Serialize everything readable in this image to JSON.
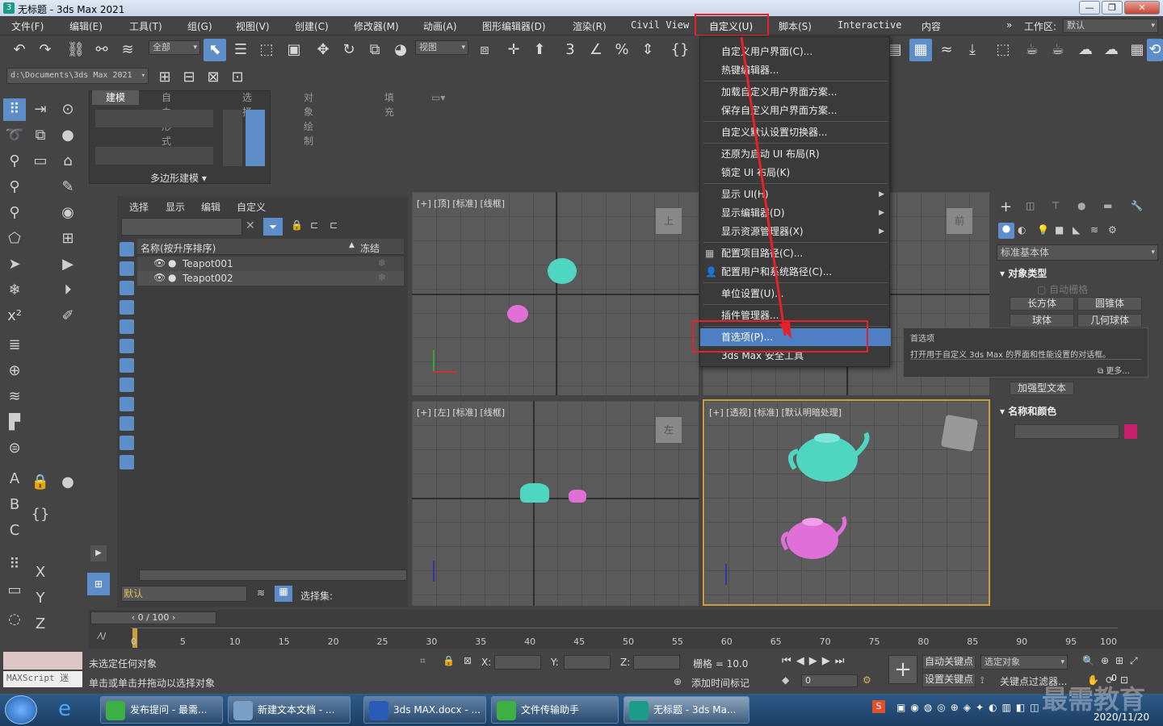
{
  "window": {
    "title": "无标题 - 3ds Max 2021",
    "controls": [
      "—",
      "❐",
      "✕"
    ]
  },
  "menubar": {
    "items": [
      "文件(F)",
      "编辑(E)",
      "工具(T)",
      "组(G)",
      "视图(V)",
      "创建(C)",
      "修改器(M)",
      "动画(A)",
      "图形编辑器(D)",
      "渲染(R)",
      "Civil View",
      "自定义(U)",
      "脚本(S)",
      "Interactive",
      "内容"
    ],
    "workspace_label": "工作区:",
    "workspace_value": "默认"
  },
  "toolbar": {
    "filter_value": "全部",
    "view_value": "视图",
    "path_value": "d:\\Documents\\3ds Max 2021"
  },
  "ribbon": {
    "tabs": [
      "建模",
      "自由形式",
      "选择",
      "对象绘制",
      "填充"
    ],
    "panel_label": "多边形建模"
  },
  "scene_explorer": {
    "menu": [
      "选择",
      "显示",
      "编辑",
      "自定义"
    ],
    "column_name": "名称(按升序排序)",
    "column_freeze": "冻结",
    "rows": [
      "Teapot001",
      "Teapot002"
    ],
    "layer_value": "默认",
    "selection_set_label": "选择集:"
  },
  "viewports": {
    "top": "[+] [顶] [标准] [线框]",
    "left": "[+] [左] [标准] [线框]",
    "perspective": "[+] [透视] [标准] [默认明暗处理]",
    "top_cube": "上",
    "front_cube": "前",
    "left_cube": "左"
  },
  "dropdown_menu": {
    "items": [
      "自定义用户界面(C)...",
      "热键编辑器...",
      "加载自定义用户界面方案...",
      "保存自定义用户界面方案...",
      "自定义默认设置切换器...",
      "还原为启动 UI 布局(R)",
      "锁定 UI 布局(K)",
      "显示 UI(H)",
      "显示编辑器(D)",
      "显示资源管理器(X)",
      "配置项目路径(C)...",
      "配置用户和系统路径(C)...",
      "单位设置(U)...",
      "插件管理器...",
      "首选项(P)...",
      "3ds Max 安全工具"
    ]
  },
  "tooltip": {
    "title": "首选项",
    "body": "打开用于自定义 3ds Max 的界面和性能设置的对话框。",
    "more": "更多..."
  },
  "command_panel": {
    "category": "标准基本体",
    "section_object_type": "对象类型",
    "autogrid": "自动栅格",
    "buttons": [
      "长方体",
      "圆锥体",
      "球体",
      "几何球体",
      "加强型文本"
    ],
    "section_name_color": "名称和颜色"
  },
  "timeline": {
    "frame_counter": "0 / 100",
    "ticks": [
      "0",
      "5",
      "10",
      "15",
      "20",
      "25",
      "30",
      "35",
      "40",
      "45",
      "50",
      "55",
      "60",
      "65",
      "70",
      "75",
      "80",
      "85",
      "90",
      "95",
      "100"
    ]
  },
  "status": {
    "maxscript": "MAXScript 迷",
    "line1": "未选定任何对象",
    "line2": "单击或单击并拖动以选择对象",
    "x_label": "X:",
    "y_label": "Y:",
    "z_label": "Z:",
    "grid": "栅格 = 10.0",
    "add_time_tag": "添加时间标记",
    "auto_key": "自动关键点",
    "selected_object": "选定对象",
    "set_key": "设置关键点",
    "key_filter": "关键点过滤器...",
    "frame_value": "0",
    "cursor_value": "0"
  },
  "taskbar": {
    "tasks": [
      "发布提问 - 最需...",
      "新建文本文档 - ...",
      "3ds MAX.docx - ...",
      "文件传输助手",
      "无标题 - 3ds Ma..."
    ],
    "time": "2020/11/20",
    "watermark": "最需教育"
  },
  "colors": {
    "accent_blue": "#4e7fc4",
    "highlight_red": "#e8202a",
    "teapot_cyan": "#4fd6c0",
    "teapot_pink": "#e070d8"
  }
}
